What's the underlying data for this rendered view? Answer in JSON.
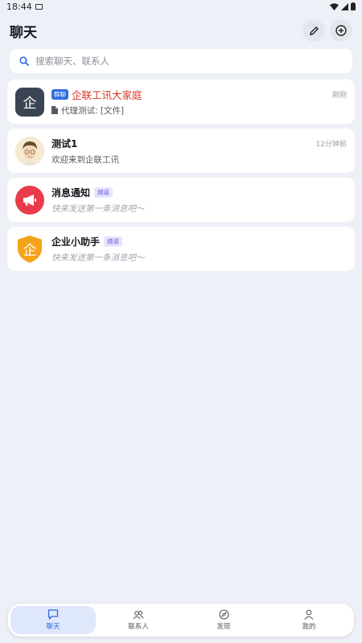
{
  "status_bar": {
    "time": "18:44"
  },
  "header": {
    "title": "聊天"
  },
  "search": {
    "placeholder": "搜索聊天、联系人"
  },
  "chats": [
    {
      "badge": "群聊",
      "name": "企联工讯大家庭",
      "time": "刚刚",
      "preview": "代理测试: [文件]",
      "avatar_text": "企"
    },
    {
      "name": "测试1",
      "time": "12分钟前",
      "preview": "欢迎来到企联工讯"
    },
    {
      "name": "消息通知",
      "channel_badge": "频道",
      "preview": "快来发送第一条消息吧～"
    },
    {
      "name": "企业小助手",
      "channel_badge": "频道",
      "preview": "快来发送第一条消息吧～",
      "avatar_text": "企"
    }
  ],
  "tabs": [
    {
      "label": "聊天",
      "icon": "chat-bubble-icon",
      "active": true
    },
    {
      "label": "联系人",
      "icon": "contacts-icon"
    },
    {
      "label": "发现",
      "icon": "compass-icon"
    },
    {
      "label": "我的",
      "icon": "profile-icon"
    }
  ],
  "colors": {
    "accent": "#2d6cdf",
    "group_name": "#d9372c",
    "background": "#eef0f7"
  }
}
